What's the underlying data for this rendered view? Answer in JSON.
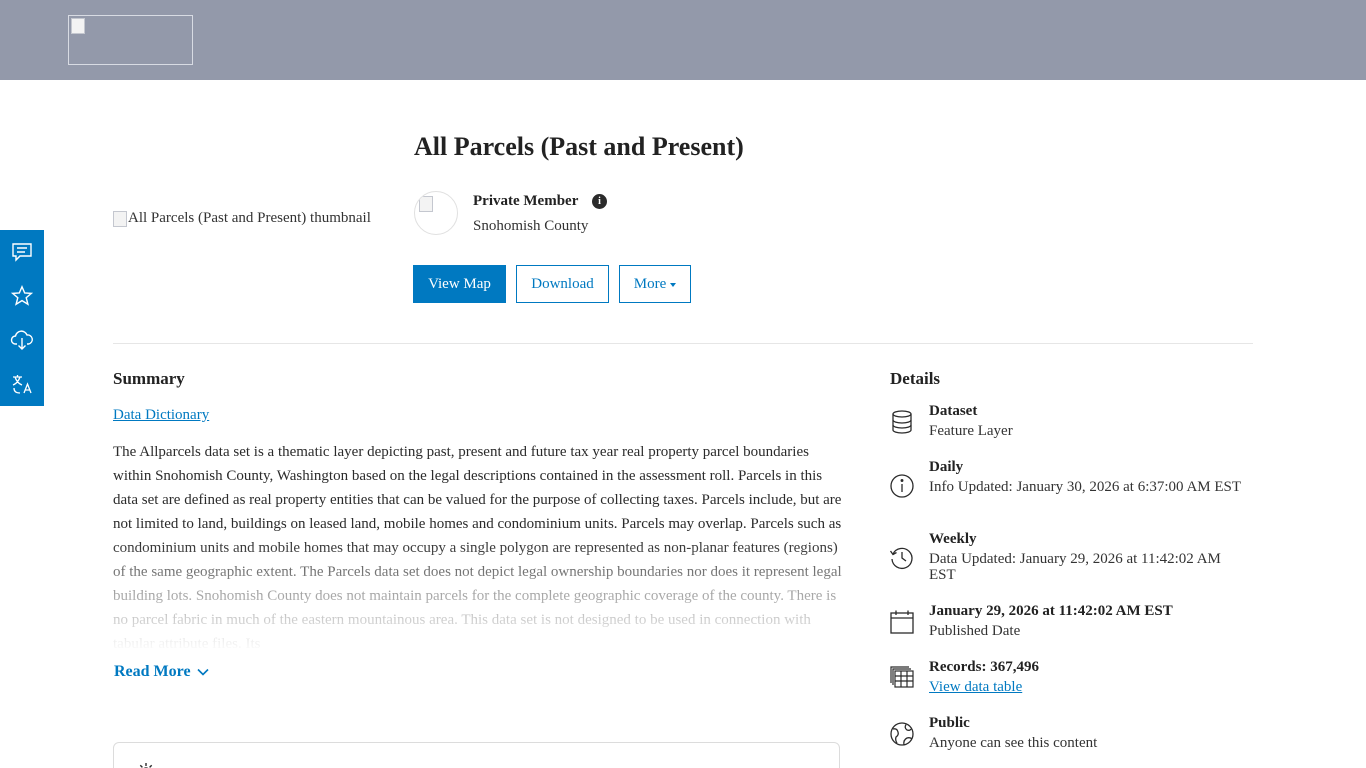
{
  "header": {
    "logo_alt": ""
  },
  "side_rail": {
    "items": [
      {
        "icon": "comment-icon",
        "label": ""
      },
      {
        "icon": "star-icon",
        "label": ""
      },
      {
        "icon": "cloud-download-icon",
        "label": ""
      },
      {
        "icon": "translate-icon",
        "label": ""
      }
    ]
  },
  "item": {
    "title": "All Parcels (Past and Present)",
    "thumbnail_alt": "All Parcels (Past and Present) thumbnail",
    "owner_name": "Private Member",
    "owner_org": "Snohomish County",
    "info_glyph": "i"
  },
  "actions": {
    "view_map": "View Map",
    "download": "Download",
    "more": "More"
  },
  "summary": {
    "heading": "Summary",
    "link": "Data Dictionary",
    "text": "The Allparcels data set is a thematic layer depicting past, present and future tax year real property parcel boundaries within Snohomish County, Washington based on the legal descriptions contained in the assessment roll. Parcels in this data set are defined as real property entities that can be valued for the purpose of collecting taxes. Parcels include, but are not limited to land, buildings on leased land, mobile homes and condominium units. Parcels may overlap. Parcels such as condominium units and mobile homes that may occupy a single polygon are represented as non-planar features (regions) of the same geographic extent. The Parcels data set does not depict legal ownership boundaries nor does it represent legal building lots. Snohomish County does not maintain parcels for the complete geographic coverage of the county. There is no parcel fabric in much of the eastern mountainous area. This data set is not designed to be used in connection with tabular attribute files. Its",
    "read_more": "Read More"
  },
  "details": {
    "heading": "Details",
    "rows": [
      {
        "icon": "database-icon",
        "title": "Dataset",
        "sub": "Feature Layer"
      },
      {
        "icon": "info-circle-icon",
        "title": "Daily",
        "sub": "Info Updated: January 30, 2026 at 6:37:00 AM EST"
      },
      {
        "icon": "history-icon",
        "title": "Weekly",
        "sub": "Data Updated: January 29, 2026 at 11:42:02 AM EST"
      },
      {
        "icon": "calendar-icon",
        "title": "January 29, 2026 at 11:42:02 AM EST",
        "sub": "Published Date"
      },
      {
        "icon": "table-icon",
        "title": "Records: 367,496",
        "sub": "View data table"
      },
      {
        "icon": "globe-icon",
        "title": "Public",
        "sub": "Anyone can see this content"
      }
    ]
  },
  "colors": {
    "header_bg": "#9399aa",
    "accent": "#0079c1",
    "text": "#2b2b2b"
  }
}
